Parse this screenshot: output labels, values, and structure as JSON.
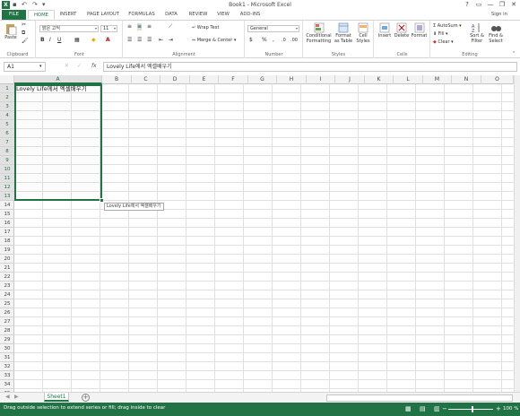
{
  "window": {
    "title": "Book1 - Microsoft Excel",
    "help": "?",
    "minimize": "—",
    "restore": "❐",
    "close": "✕"
  },
  "qat": {
    "save": "💾",
    "undo": "↶",
    "redo": "↷",
    "more": "▾"
  },
  "tabs": [
    {
      "label": "FILE"
    },
    {
      "label": "HOME"
    },
    {
      "label": "INSERT"
    },
    {
      "label": "PAGE LAYOUT"
    },
    {
      "label": "FORMULAS"
    },
    {
      "label": "DATA"
    },
    {
      "label": "REVIEW"
    },
    {
      "label": "VIEW"
    },
    {
      "label": "ADD-INS"
    }
  ],
  "signin": "Sign in",
  "ribbon": {
    "clipboard": {
      "paste": "Paste",
      "label": "Clipboard"
    },
    "font": {
      "name": "맑은 고딕",
      "size": "11",
      "label": "Font",
      "bold": "B",
      "italic": "I",
      "underline": "U"
    },
    "alignment": {
      "wrap": "Wrap Text",
      "merge": "Merge & Center",
      "label": "Alignment"
    },
    "number": {
      "format": "General",
      "label": "Number",
      "currency": "$",
      "percent": "%",
      "comma": ","
    },
    "styles": {
      "conditional": "Conditional Formatting",
      "format_table": "Format as Table",
      "cell_styles": "Cell Styles",
      "label": "Styles"
    },
    "cells": {
      "insert": "Insert",
      "delete": "Delete",
      "format": "Format",
      "label": "Cells"
    },
    "editing": {
      "autosum": "AutoSum",
      "fill": "Fill",
      "clear": "Clear",
      "sort": "Sort & Filter",
      "find": "Find & Select",
      "label": "Editing"
    }
  },
  "formula_bar": {
    "name_box": "A1",
    "fx": "fx",
    "cancel": "✕",
    "enter": "✓",
    "content": "Lovely Life에서 엑셀배우기"
  },
  "columns": [
    "A",
    "B",
    "C",
    "D",
    "E",
    "F",
    "G",
    "H",
    "I",
    "J",
    "K",
    "L",
    "M",
    "N",
    "O"
  ],
  "rows": [
    "1",
    "2",
    "3",
    "4",
    "5",
    "6",
    "7",
    "8",
    "9",
    "10",
    "11",
    "12",
    "13",
    "14",
    "15",
    "16",
    "17",
    "18",
    "19",
    "20",
    "21",
    "22",
    "23",
    "24",
    "25",
    "26",
    "27",
    "28",
    "29",
    "30",
    "31",
    "32",
    "33",
    "34",
    "35"
  ],
  "cell_a1": "Lovely Life에서 엑셀배우기",
  "tooltip": "Lovely Life에서 엑셀배우기",
  "sheets": [
    {
      "label": "Sheet1"
    }
  ],
  "add_sheet": "+",
  "status": {
    "message": "Drag outside selection to extend series or fill; drag inside to clear",
    "zoom": "100 %"
  }
}
